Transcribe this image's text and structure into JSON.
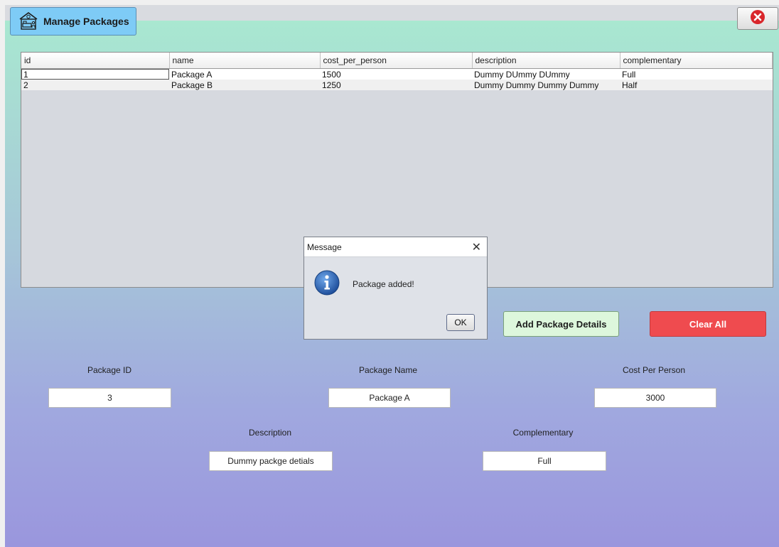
{
  "window": {
    "title": "Manage Packages"
  },
  "table": {
    "columns": [
      "id",
      "name",
      "cost_per_person",
      "description",
      "complementary"
    ],
    "rows": [
      [
        "1",
        "Package A",
        "1500",
        "Dummy DUmmy DUmmy",
        "Full"
      ],
      [
        "2",
        "Package B",
        "1250",
        "Dummy Dummy Dummy Dummy",
        "Half"
      ]
    ]
  },
  "buttons": {
    "add_label": "Add Package Details",
    "clear_label": "Clear All"
  },
  "form": {
    "package_id": {
      "label": "Package ID",
      "value": "3"
    },
    "package_name": {
      "label": "Package Name",
      "value": "Package A"
    },
    "cost_per_person": {
      "label": "Cost Per Person",
      "value": "3000"
    },
    "description": {
      "label": "Description",
      "value": "Dummy packge detials"
    },
    "complementary": {
      "label": "Complementary",
      "value": "Full"
    }
  },
  "dialog": {
    "title": "Message",
    "message": "Package added!",
    "ok_label": "OK",
    "close_glyph": "✕"
  },
  "icons": {
    "title_icon": "hotel-room-icon",
    "close_icon": "close-circle-icon",
    "dialog_icon": "info-icon"
  },
  "colors": {
    "title_button": "#7ecbf6",
    "add_button": "#ddf7dc",
    "clear_button": "#ef4b4f",
    "close_icon": "#d9262b",
    "info_icon": "#2f6dbf"
  }
}
